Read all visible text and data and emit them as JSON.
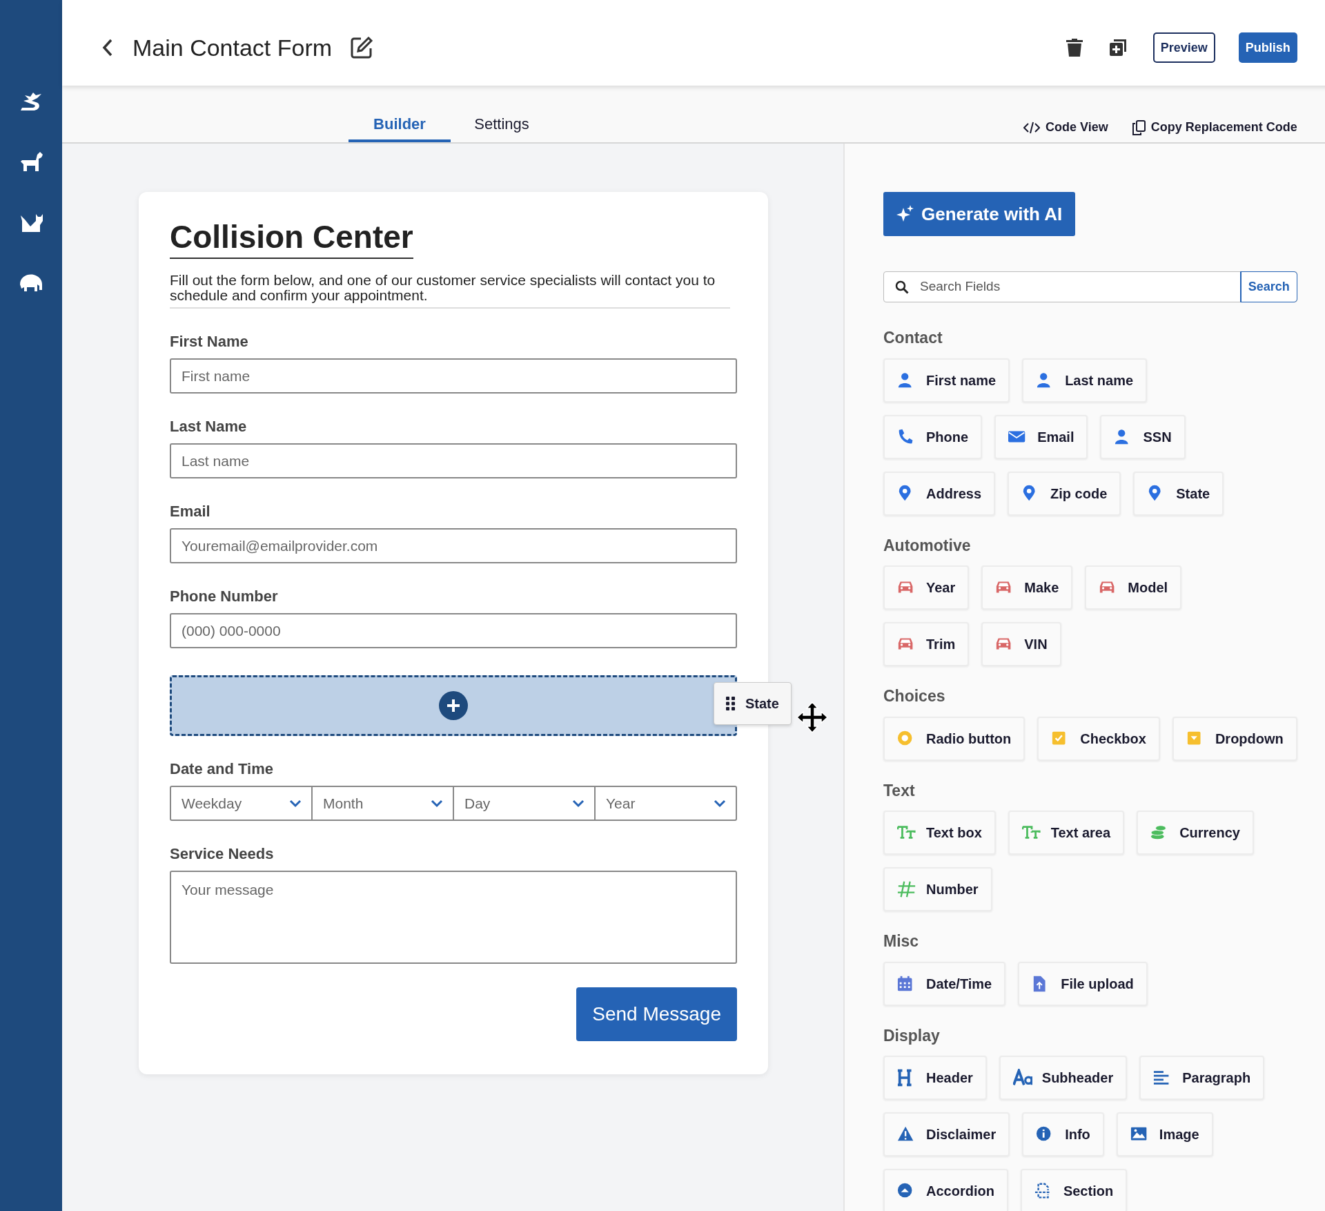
{
  "header": {
    "title": "Main Contact Form",
    "preview": "Preview",
    "publish": "Publish"
  },
  "tabs": [
    {
      "label": "Builder",
      "selected": true
    },
    {
      "label": "Settings",
      "selected": false
    }
  ],
  "tools": [
    "Code View",
    "Copy Replacement Code"
  ],
  "form": {
    "title": "Collision Center",
    "description": "Fill out the form below, and one of our customer service specialists will contact you to schedule and confirm your appointment.",
    "fields": [
      {
        "kind": "input",
        "label": "First Name",
        "placeholder": "First name"
      },
      {
        "kind": "input",
        "label": "Last Name",
        "placeholder": "Last name"
      },
      {
        "kind": "input",
        "label": "Email",
        "placeholder": "Youremail@emailprovider.com"
      },
      {
        "kind": "input",
        "label": "Phone Number",
        "placeholder": "(000) 000-0000"
      },
      {
        "kind": "dropzone",
        "drag_label": "State"
      },
      {
        "kind": "selects",
        "label": "Date and Time",
        "options": [
          "Weekday",
          "Month",
          "Day",
          "Year"
        ]
      },
      {
        "kind": "textarea",
        "label": "Service Needs",
        "placeholder": "Your message"
      }
    ],
    "submit": "Send Message"
  },
  "panel": {
    "ai_button": "Generate with AI",
    "search": {
      "placeholder": "Search Fields",
      "button": "Search"
    },
    "groups": [
      {
        "title": "Contact",
        "rows": [
          [
            "First name",
            "Last name"
          ],
          [
            "Phone",
            "Email",
            "SSN"
          ],
          [
            "Address",
            "Zip code",
            "State"
          ]
        ]
      },
      {
        "title": "Automotive",
        "rows": [
          [
            "Year",
            "Make",
            "Model"
          ],
          [
            "Trim",
            "VIN"
          ]
        ]
      },
      {
        "title": "Choices",
        "rows": [
          [
            "Radio button",
            "Checkbox",
            "Dropdown"
          ]
        ]
      },
      {
        "title": "Text",
        "rows": [
          [
            "Text box",
            "Text area",
            "Currency"
          ],
          [
            "Number"
          ]
        ]
      },
      {
        "title": "Misc",
        "rows": [
          [
            "Date/Time",
            "File upload"
          ]
        ]
      },
      {
        "title": "Display",
        "rows": [
          [
            "Header",
            "Subheader",
            "Paragraph"
          ],
          [
            "Disclaimer",
            "Info",
            "Image"
          ],
          [
            "Accordion",
            "Section"
          ]
        ]
      }
    ]
  }
}
